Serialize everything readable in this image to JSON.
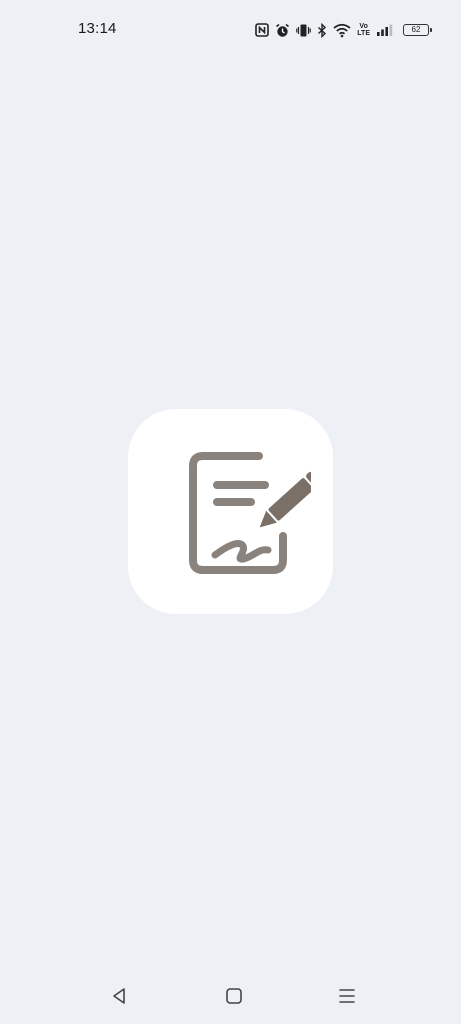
{
  "status_bar": {
    "time": "13:14",
    "volte_top": "Vo",
    "volte_bottom": "LTE",
    "battery_level": "62",
    "icons": [
      "nfc-icon",
      "alarm-icon",
      "vibrate-icon",
      "bluetooth-icon",
      "wifi-icon",
      "volte-icon",
      "signal-icon",
      "battery-icon"
    ]
  },
  "splash": {
    "logo_icon": "document-signature-icon",
    "logo_color": "#7a7068"
  },
  "nav_bar": {
    "icons": [
      "back-icon",
      "home-icon",
      "recents-icon"
    ]
  },
  "colors": {
    "background": "#edf0f5",
    "logo_background": "#ffffff"
  }
}
